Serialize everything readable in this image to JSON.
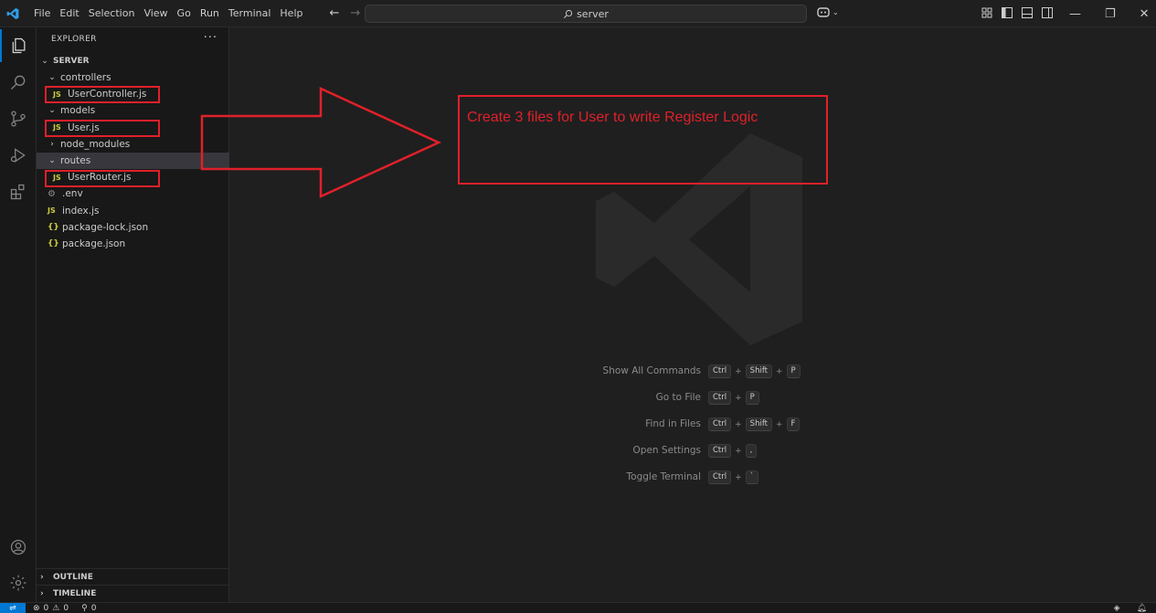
{
  "titlebar": {
    "menu": [
      "File",
      "Edit",
      "Selection",
      "View",
      "Go",
      "Run",
      "Terminal",
      "Help"
    ],
    "search_text": "server"
  },
  "sidebar": {
    "header": "EXPLORER",
    "more": "···",
    "root": "SERVER",
    "tree": [
      {
        "label": "controllers",
        "kind": "folder-open",
        "depth": 1
      },
      {
        "label": "UserController.js",
        "kind": "js",
        "depth": 2
      },
      {
        "label": "models",
        "kind": "folder-open",
        "depth": 1
      },
      {
        "label": "User.js",
        "kind": "js",
        "depth": 2
      },
      {
        "label": "node_modules",
        "kind": "folder-closed",
        "depth": 1
      },
      {
        "label": "routes",
        "kind": "folder-open",
        "depth": 1,
        "selected": true
      },
      {
        "label": "UserRouter.js",
        "kind": "js",
        "depth": 2
      },
      {
        "label": ".env",
        "kind": "env",
        "depth": 1
      },
      {
        "label": "index.js",
        "kind": "js",
        "depth": 1
      },
      {
        "label": "package-lock.json",
        "kind": "json",
        "depth": 1
      },
      {
        "label": "package.json",
        "kind": "json",
        "depth": 1
      }
    ],
    "outline": "OUTLINE",
    "timeline": "TIMELINE"
  },
  "editor": {
    "shortcuts": [
      {
        "label": "Show All Commands",
        "keys": [
          "Ctrl",
          "Shift",
          "P"
        ]
      },
      {
        "label": "Go to File",
        "keys": [
          "Ctrl",
          "P"
        ]
      },
      {
        "label": "Find in Files",
        "keys": [
          "Ctrl",
          "Shift",
          "F"
        ]
      },
      {
        "label": "Open Settings",
        "keys": [
          "Ctrl",
          ","
        ]
      },
      {
        "label": "Toggle Terminal",
        "keys": [
          "Ctrl",
          "`"
        ]
      }
    ]
  },
  "annotation": {
    "text": "Create 3 files for User to write Register Logic",
    "color": "#e0202a"
  },
  "statusbar": {
    "errors": "0",
    "warnings": "0",
    "ports": "0"
  },
  "colors": {
    "accent": "#0078d4",
    "background": "#1f1f1f",
    "sidebar": "#181818",
    "js_icon": "#cbcb41"
  }
}
